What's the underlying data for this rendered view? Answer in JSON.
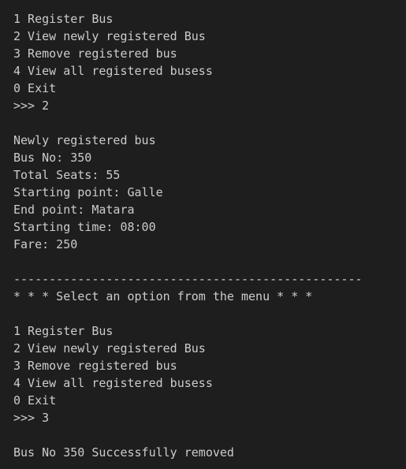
{
  "menu_first": [
    "1 Register Bus",
    "2 View newly registered Bus",
    "3 Remove registered bus",
    "4 View all registered busess",
    "0 Exit"
  ],
  "prompt_first": ">>> 2",
  "bus_details": [
    "Newly registered bus",
    "Bus No: 350",
    "Total Seats: 55",
    "Starting point: Galle",
    "End point: Matara",
    "Starting time: 08:00",
    "Fare: 250"
  ],
  "separator": "-------------------------------------------------",
  "menu_heading": "* * * Select an option from the menu * * *",
  "menu_second": [
    "1 Register Bus",
    "2 View newly registered Bus",
    "3 Remove registered bus",
    "4 View all registered busess",
    "0 Exit"
  ],
  "prompt_second": ">>> 3",
  "result_message": "Bus No 350 Successfully removed"
}
